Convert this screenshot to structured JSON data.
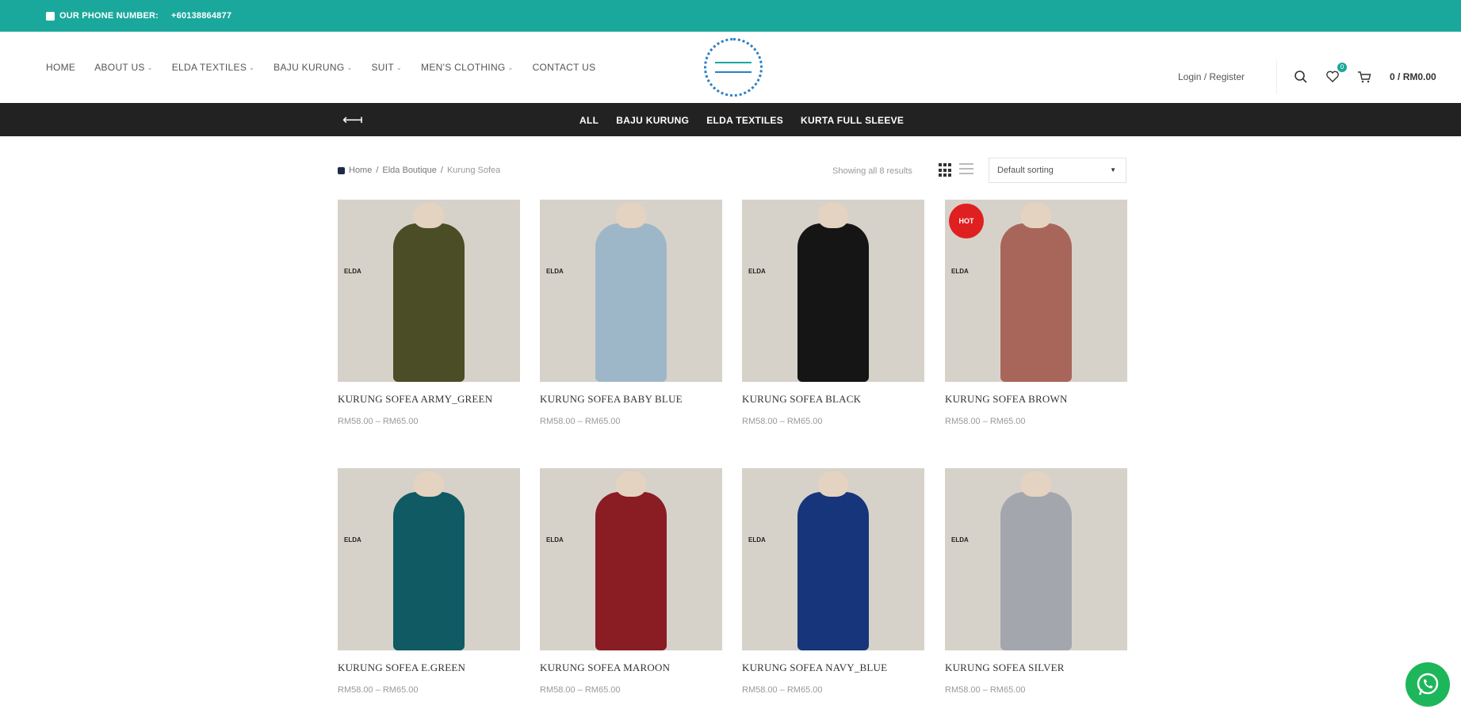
{
  "topbar": {
    "phone_label": "OUR PHONE NUMBER:",
    "phone_number": "+60138864877"
  },
  "nav": {
    "items": [
      {
        "label": "HOME",
        "dropdown": false
      },
      {
        "label": "ABOUT US",
        "dropdown": true
      },
      {
        "label": "ELDA TEXTILES",
        "dropdown": true
      },
      {
        "label": "BAJU KURUNG",
        "dropdown": true
      },
      {
        "label": "SUIT",
        "dropdown": true
      },
      {
        "label": "MEN'S CLOTHING",
        "dropdown": true
      },
      {
        "label": "CONTACT US",
        "dropdown": false
      }
    ]
  },
  "header": {
    "login_label": "Login / Register",
    "wishlist_count": "0",
    "cart_count": "0",
    "cart_total": "RM0.00",
    "cart_label": "0 /"
  },
  "categories": {
    "items": [
      "ALL",
      "BAJU KURUNG",
      "ELDA TEXTILES",
      "KURTA FULL SLEEVE"
    ]
  },
  "breadcrumb": {
    "home": "Home",
    "parent": "Elda Boutique",
    "current": "Kurung Sofea"
  },
  "toolbar": {
    "results_text": "Showing all 8 results",
    "sort_label": "Default sorting"
  },
  "products": [
    {
      "title": "KURUNG SOFEA ARMY_GREEN",
      "price": "RM58.00 – RM65.00",
      "color": "#4b4d26",
      "hot": false,
      "brand": "ELDA"
    },
    {
      "title": "KURUNG SOFEA BABY BLUE",
      "price": "RM58.00 – RM65.00",
      "color": "#9db7c8",
      "hot": false,
      "brand": "ELDA"
    },
    {
      "title": "KURUNG SOFEA BLACK",
      "price": "RM58.00 – RM65.00",
      "color": "#151515",
      "hot": false,
      "brand": "ELDA"
    },
    {
      "title": "KURUNG SOFEA BROWN",
      "price": "RM58.00 – RM65.00",
      "color": "#a8665a",
      "hot": true,
      "hot_label": "HOT",
      "brand": "ELDA"
    },
    {
      "title": "KURUNG SOFEA E.GREEN",
      "price": "RM58.00 – RM65.00",
      "color": "#0f5a63",
      "hot": false,
      "brand": "ELDA"
    },
    {
      "title": "KURUNG SOFEA MAROON",
      "price": "RM58.00 – RM65.00",
      "color": "#8a1c24",
      "hot": false,
      "brand": "ELDA"
    },
    {
      "title": "KURUNG SOFEA NAVY_BLUE",
      "price": "RM58.00 – RM65.00",
      "color": "#16357a",
      "hot": false,
      "brand": "ELDA"
    },
    {
      "title": "KURUNG SOFEA SILVER",
      "price": "RM58.00 – RM65.00",
      "color": "#a4a6ae",
      "hot": false,
      "brand": "ELDA"
    }
  ],
  "colors": {
    "accent": "#1aa89c",
    "category_bar": "#222222",
    "whatsapp": "#1eb65a",
    "hot_badge": "#e02020"
  }
}
